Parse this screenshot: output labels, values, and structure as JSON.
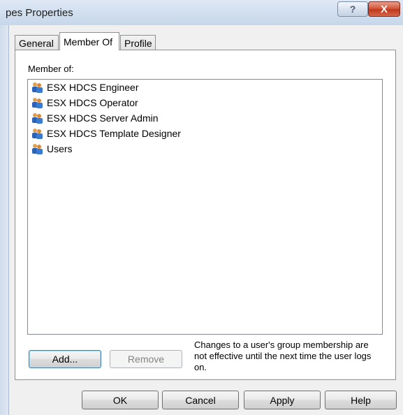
{
  "window": {
    "title": "pes Properties",
    "help_glyph": "?",
    "close_glyph": "X"
  },
  "tabs": [
    {
      "label": "General",
      "active": false
    },
    {
      "label": "Member Of",
      "active": true
    },
    {
      "label": "Profile",
      "active": false
    }
  ],
  "member_of": {
    "label": "Member of:",
    "groups": [
      {
        "name": "ESX HDCS Engineer",
        "icon": "group-icon"
      },
      {
        "name": "ESX HDCS Operator",
        "icon": "group-icon"
      },
      {
        "name": "ESX HDCS Server Admin",
        "icon": "group-icon"
      },
      {
        "name": "ESX HDCS Template Designer",
        "icon": "group-icon"
      },
      {
        "name": "Users",
        "icon": "group-icon"
      }
    ],
    "add_label": "Add...",
    "remove_label": "Remove",
    "remove_enabled": false,
    "note": "Changes to a user's group membership are not effective until the next time the user logs on."
  },
  "footer": {
    "ok_label": "OK",
    "cancel_label": "Cancel",
    "apply_label": "Apply",
    "help_label": "Help"
  },
  "colors": {
    "titlebar": "#d3e0ef",
    "close_button": "#c0391c",
    "dialog_bg": "#f0f0f0"
  }
}
